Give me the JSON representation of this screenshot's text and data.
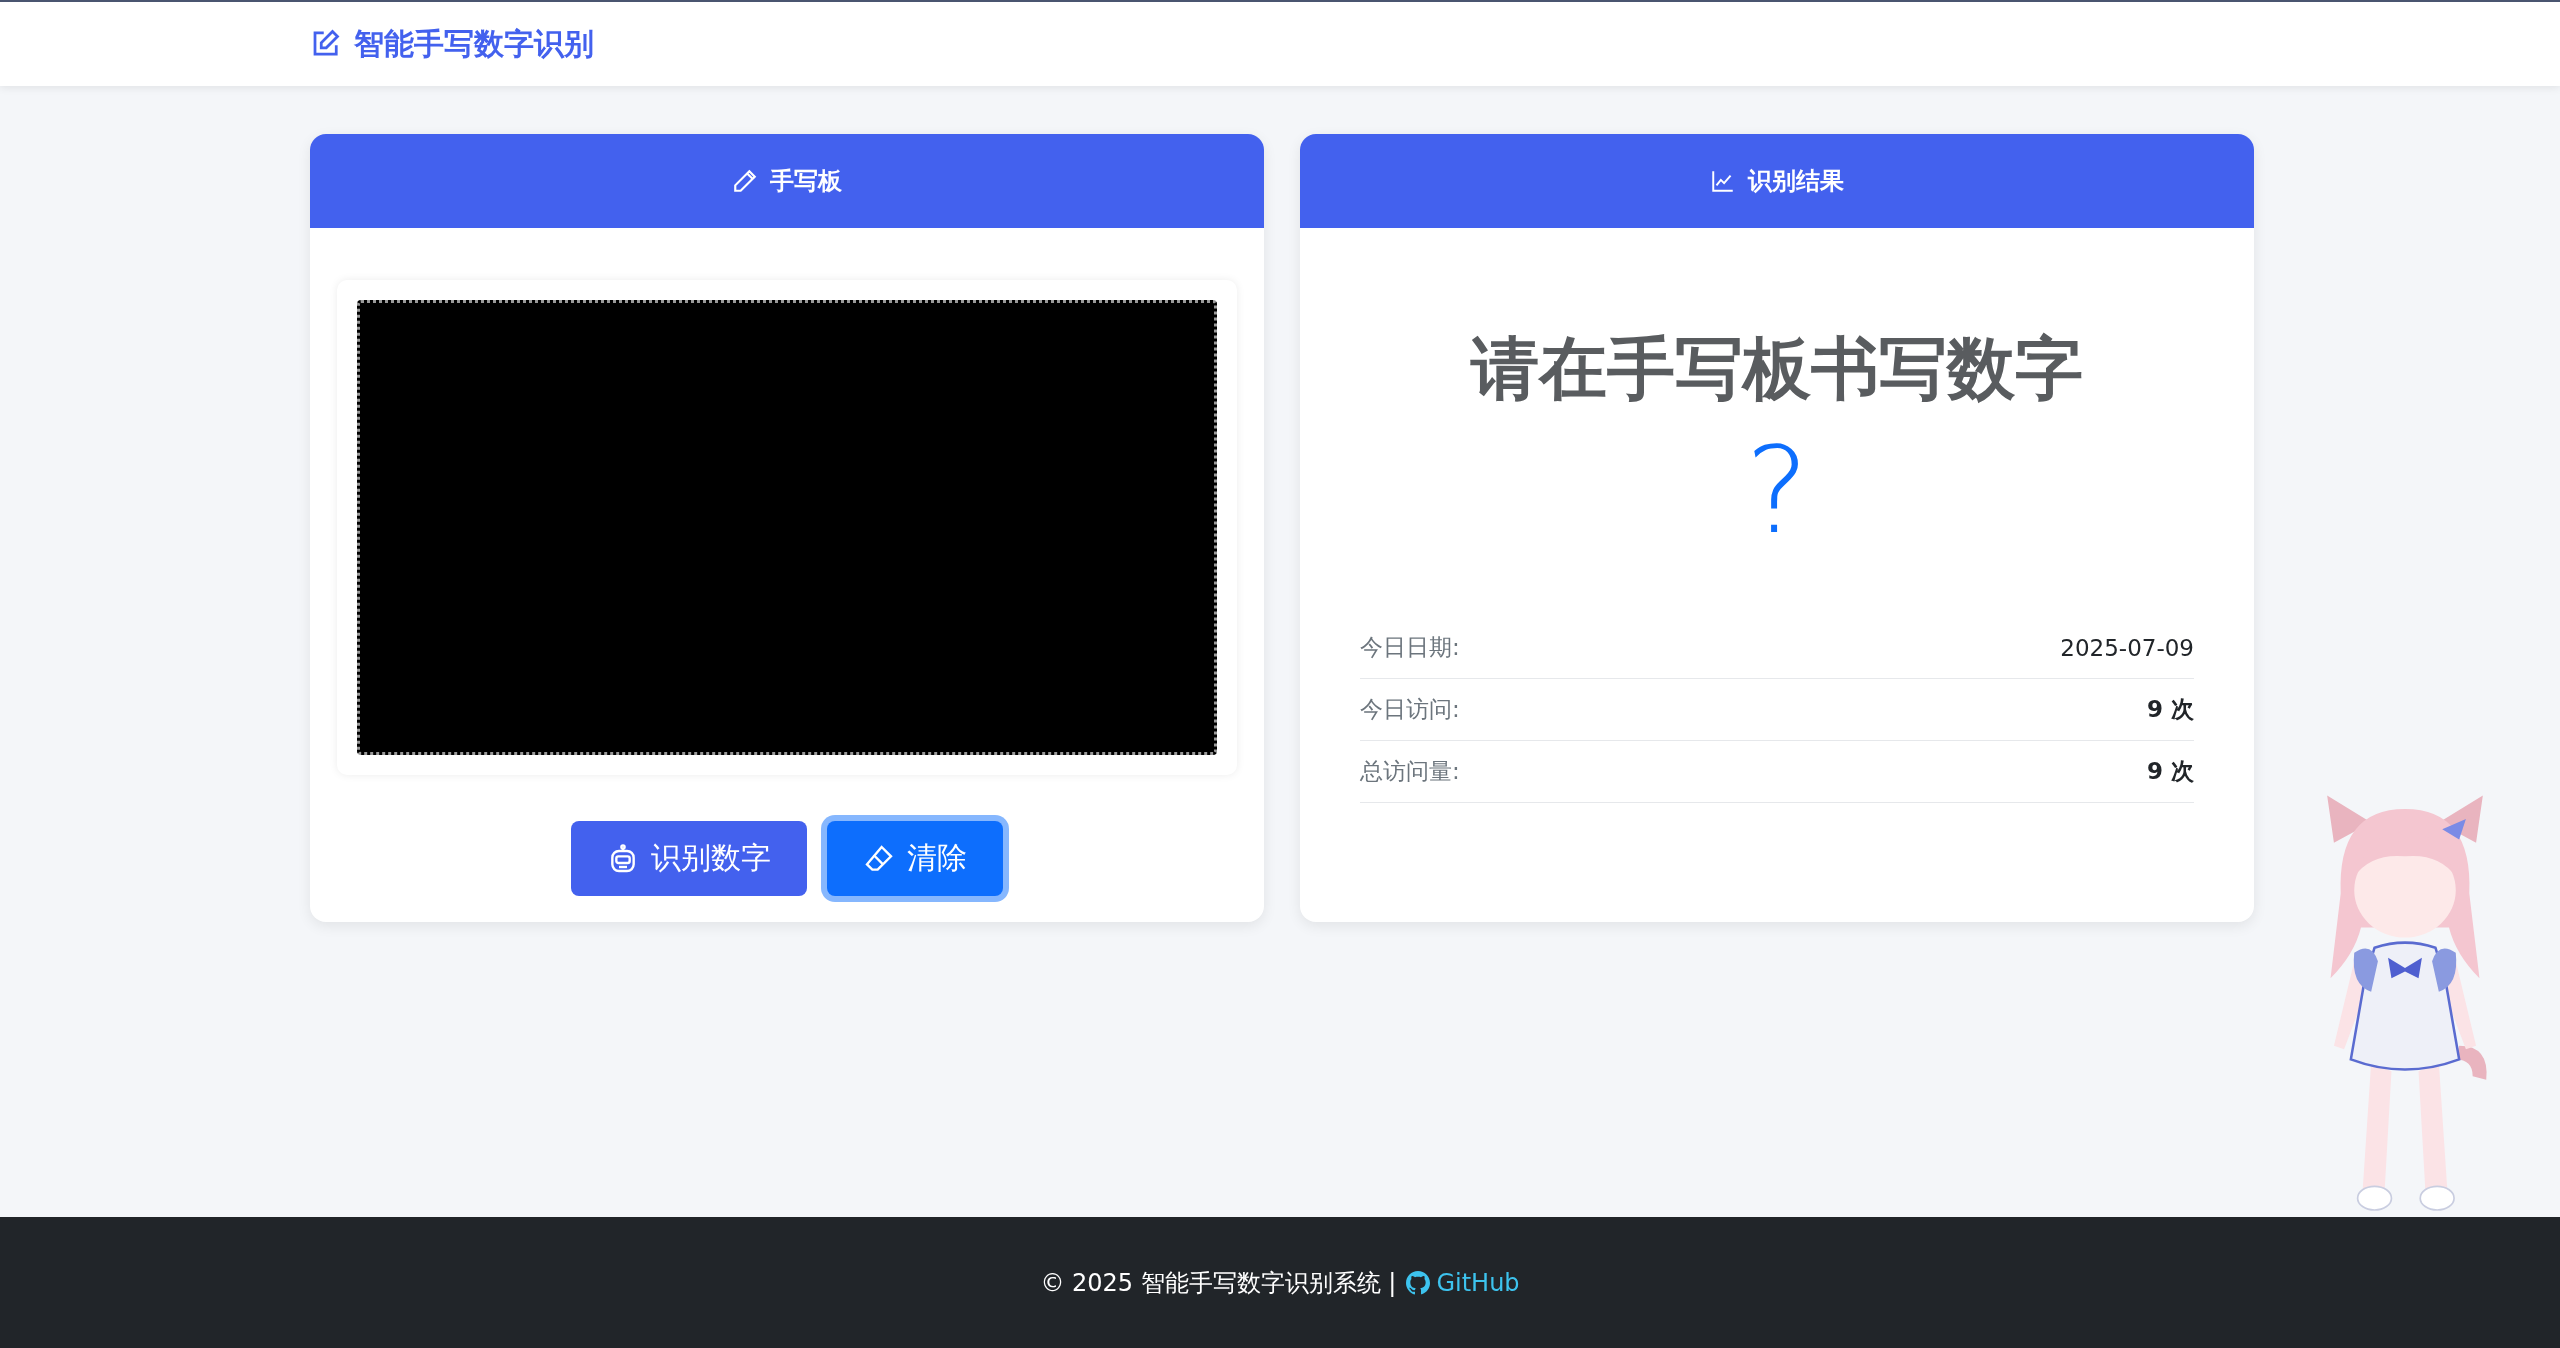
{
  "navbar": {
    "title": "智能手写数字识别"
  },
  "pad_card": {
    "title": "手写板",
    "buttons": [
      {
        "label": "识别数字",
        "kind": "recognize",
        "focused": false
      },
      {
        "label": "清除",
        "kind": "clear",
        "focused": true
      }
    ]
  },
  "result_card": {
    "title": "识别结果",
    "prompt": "请在手写板书写数字",
    "result": "?",
    "stats": [
      {
        "label": "今日日期:",
        "value": "2025-07-09",
        "bold": false
      },
      {
        "label": "今日访问:",
        "value": "9 次",
        "bold": true
      },
      {
        "label": "总访问量:",
        "value": "9 次",
        "bold": true
      }
    ]
  },
  "footer": {
    "text": "© 2025 智能手写数字识别系统 |",
    "link": "GitHub"
  }
}
